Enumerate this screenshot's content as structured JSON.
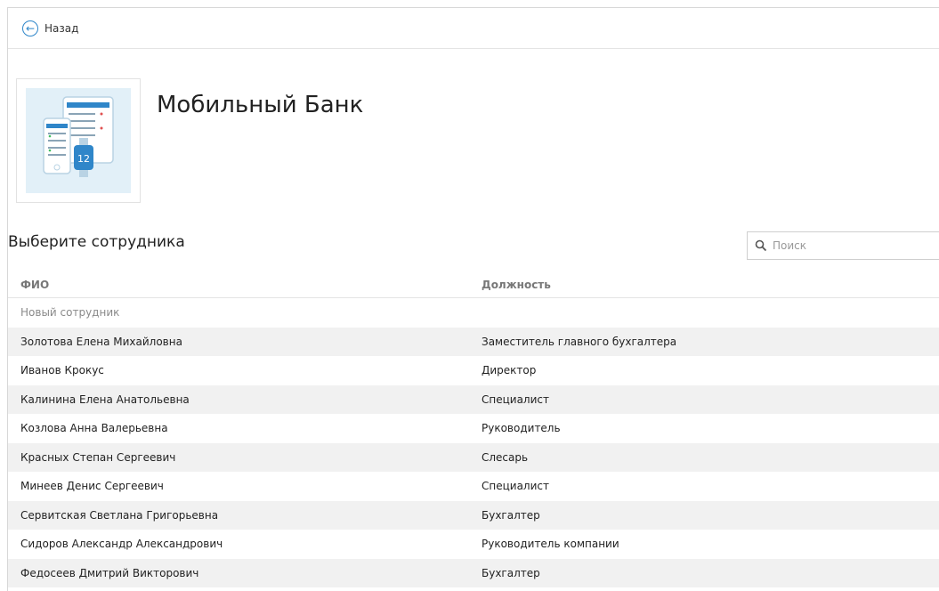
{
  "nav": {
    "back_label": "Назад",
    "back_icon": "arrow-left-circle-icon"
  },
  "app": {
    "title": "Мобильный Банк",
    "icon": "mobile-bank-app-icon"
  },
  "section": {
    "title": "Выберите сотрудника"
  },
  "search": {
    "placeholder": "Поиск",
    "icon": "search-icon"
  },
  "table": {
    "headers": {
      "name": "ФИО",
      "position": "Должность"
    },
    "rows": [
      {
        "name": "Новый сотрудник",
        "position": ""
      },
      {
        "name": "Золотова Елена Михайловна",
        "position": "Заместитель главного бухгалтера"
      },
      {
        "name": "Иванов Крокус",
        "position": "Директор"
      },
      {
        "name": "Калинина Елена Анатольевна",
        "position": "Специалист"
      },
      {
        "name": "Козлова Анна Валерьевна",
        "position": "Руководитель"
      },
      {
        "name": "Красных Степан Сергеевич",
        "position": "Слесарь"
      },
      {
        "name": "Минеев Денис Сергеевич",
        "position": "Специалист"
      },
      {
        "name": "Сервитская Светлана Григорьевна",
        "position": "Бухгалтер"
      },
      {
        "name": "Сидоров Александр Александрович",
        "position": "Руководитель компании"
      },
      {
        "name": "Федосеев Дмитрий Викторович",
        "position": "Бухгалтер"
      }
    ]
  },
  "colors": {
    "accent": "#2f86c9",
    "row_alt": "#f1f1f1",
    "thumb_bg": "#e2f0f8"
  }
}
